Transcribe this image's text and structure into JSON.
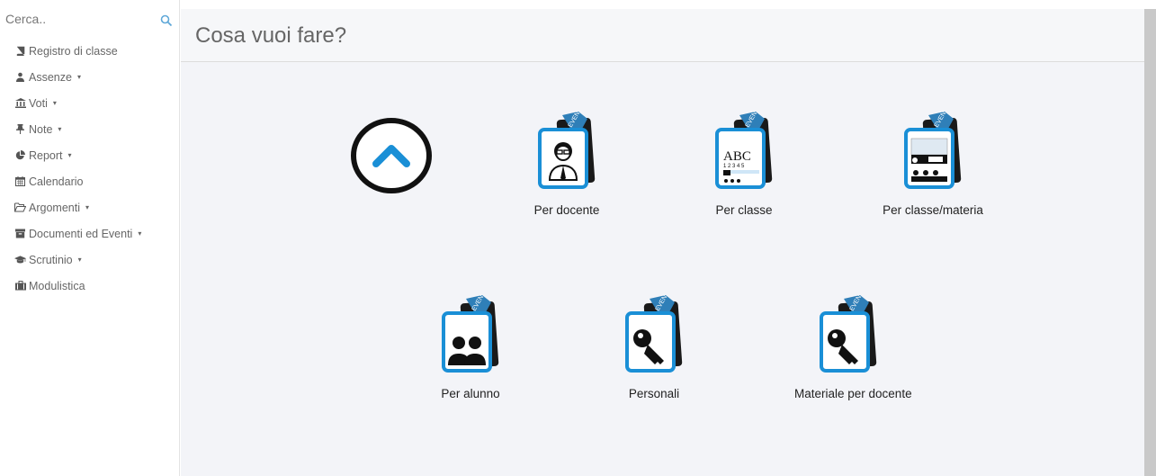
{
  "search": {
    "placeholder": "Cerca.."
  },
  "sidebar": {
    "items": [
      {
        "label": "Registro di classe",
        "icon": "book-icon",
        "has_caret": false
      },
      {
        "label": "Assenze",
        "icon": "user-icon",
        "has_caret": true
      },
      {
        "label": "Voti",
        "icon": "bank-icon",
        "has_caret": true
      },
      {
        "label": "Note",
        "icon": "pin-icon",
        "has_caret": true
      },
      {
        "label": "Report",
        "icon": "pie-chart-icon",
        "has_caret": true
      },
      {
        "label": "Calendario",
        "icon": "calendar-icon",
        "has_caret": false
      },
      {
        "label": "Argomenti",
        "icon": "folder-open-icon",
        "has_caret": true
      },
      {
        "label": "Documenti ed Eventi",
        "icon": "archive-icon",
        "has_caret": true
      },
      {
        "label": "Scrutinio",
        "icon": "graduation-cap-icon",
        "has_caret": true
      },
      {
        "label": "Modulistica",
        "icon": "briefcase-icon",
        "has_caret": false
      }
    ],
    "caret": "▾"
  },
  "main": {
    "title": "Cosa vuoi fare?",
    "tiles": [
      {
        "label": "Per docente",
        "icon": "teacher-icon"
      },
      {
        "label": "Per classe",
        "icon": "abc-board-icon"
      },
      {
        "label": "Per classe/materia",
        "icon": "lesson-icon"
      },
      {
        "label": "Per alunno",
        "icon": "students-icon"
      },
      {
        "label": "Personali",
        "icon": "key-icon"
      },
      {
        "label": "Materiale per docente",
        "icon": "key-icon"
      }
    ]
  },
  "colors": {
    "accent_blue": "#1a8fd6",
    "dark_icon": "#1a1a1a",
    "event_tag": "#2f7fb8"
  }
}
